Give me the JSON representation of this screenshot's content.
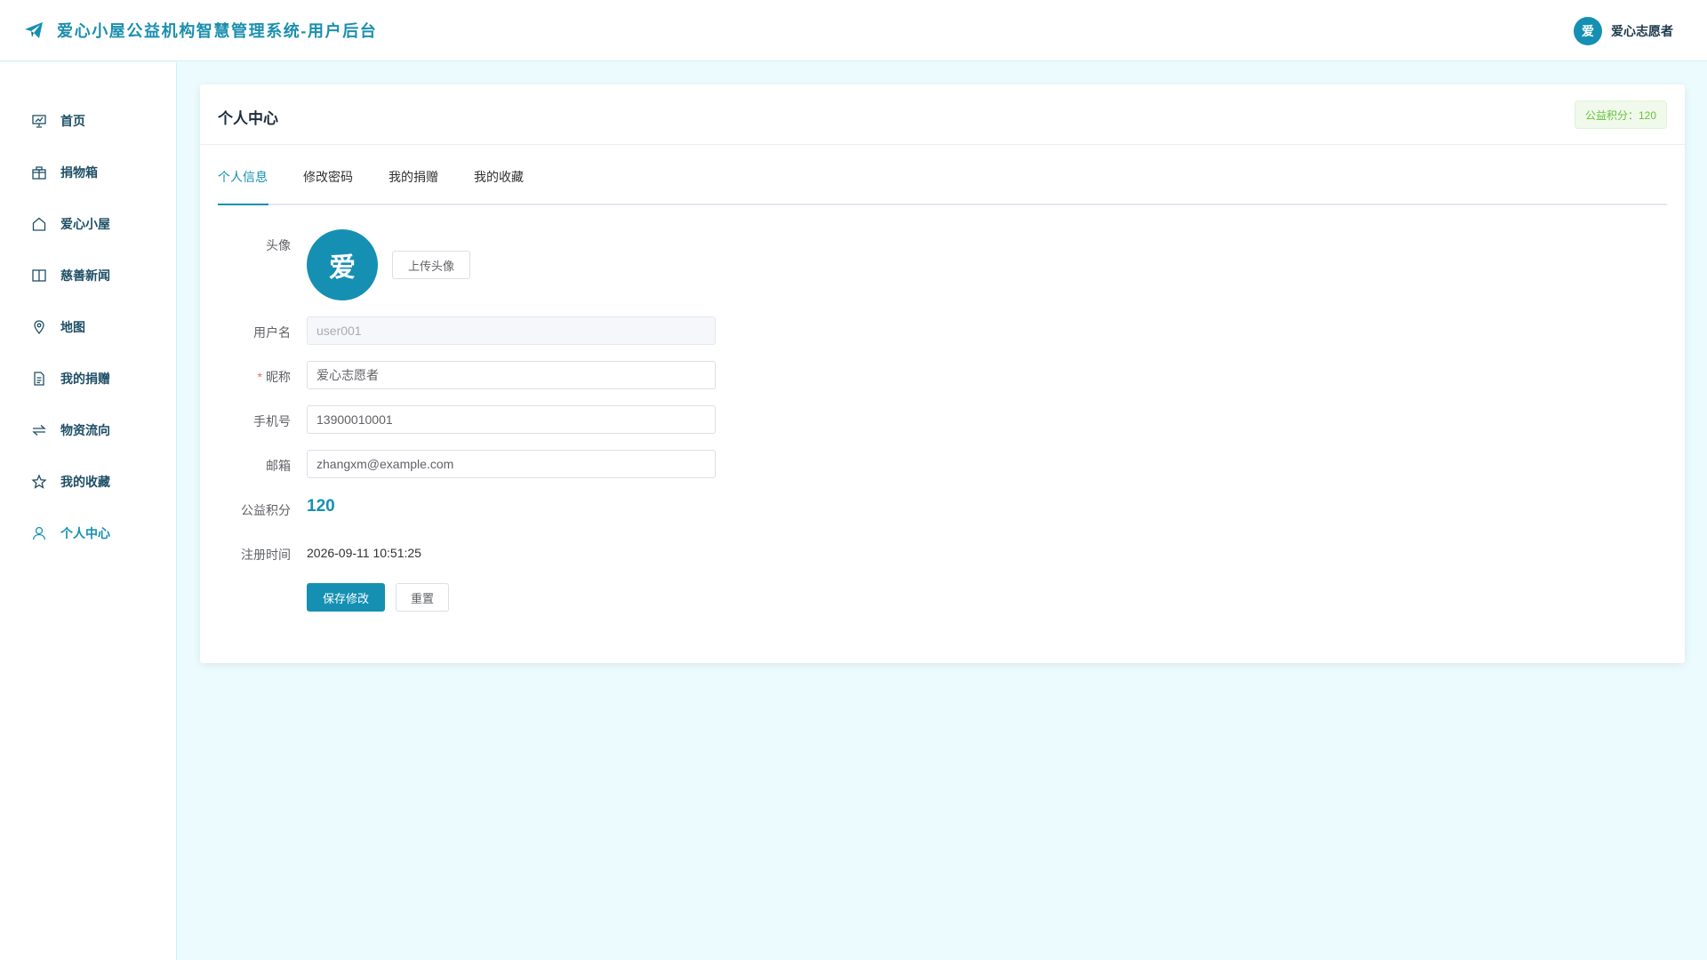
{
  "header": {
    "title": "爱心小屋公益机构智慧管理系统-用户后台",
    "user": {
      "avatar_char": "爱",
      "name": "爱心志愿者"
    }
  },
  "sidebar": {
    "items": [
      {
        "label": "首页",
        "icon": "presentation-chart-icon"
      },
      {
        "label": "捐物箱",
        "icon": "gift-box-icon"
      },
      {
        "label": "爱心小屋",
        "icon": "house-icon"
      },
      {
        "label": "慈善新闻",
        "icon": "open-book-icon"
      },
      {
        "label": "地图",
        "icon": "map-pin-icon"
      },
      {
        "label": "我的捐赠",
        "icon": "document-icon"
      },
      {
        "label": "物资流向",
        "icon": "switch-arrows-icon"
      },
      {
        "label": "我的收藏",
        "icon": "star-icon"
      },
      {
        "label": "个人中心",
        "icon": "user-icon",
        "active": true
      }
    ]
  },
  "card": {
    "title": "个人中心",
    "points_badge": "公益积分：120",
    "tabs": [
      {
        "label": "个人信息",
        "active": true
      },
      {
        "label": "修改密码"
      },
      {
        "label": "我的捐赠"
      },
      {
        "label": "我的收藏"
      }
    ]
  },
  "form": {
    "avatar": {
      "label": "头像",
      "char": "爱",
      "upload_label": "上传头像"
    },
    "username": {
      "label": "用户名",
      "value": "user001"
    },
    "nickname": {
      "label": "昵称",
      "required_mark": "*",
      "value": "爱心志愿者"
    },
    "phone": {
      "label": "手机号",
      "value": "13900010001"
    },
    "email": {
      "label": "邮箱",
      "value": "zhangxm@example.com"
    },
    "points": {
      "label": "公益积分",
      "value": "120"
    },
    "register_time": {
      "label": "注册时间",
      "value": "2026-09-11 10:51:25"
    },
    "save_label": "保存修改",
    "reset_label": "重置"
  },
  "colors": {
    "primary": "#1590b3",
    "page_background": "#ecfbfd",
    "success_text": "#67c23a",
    "required": "#f56c6c"
  }
}
